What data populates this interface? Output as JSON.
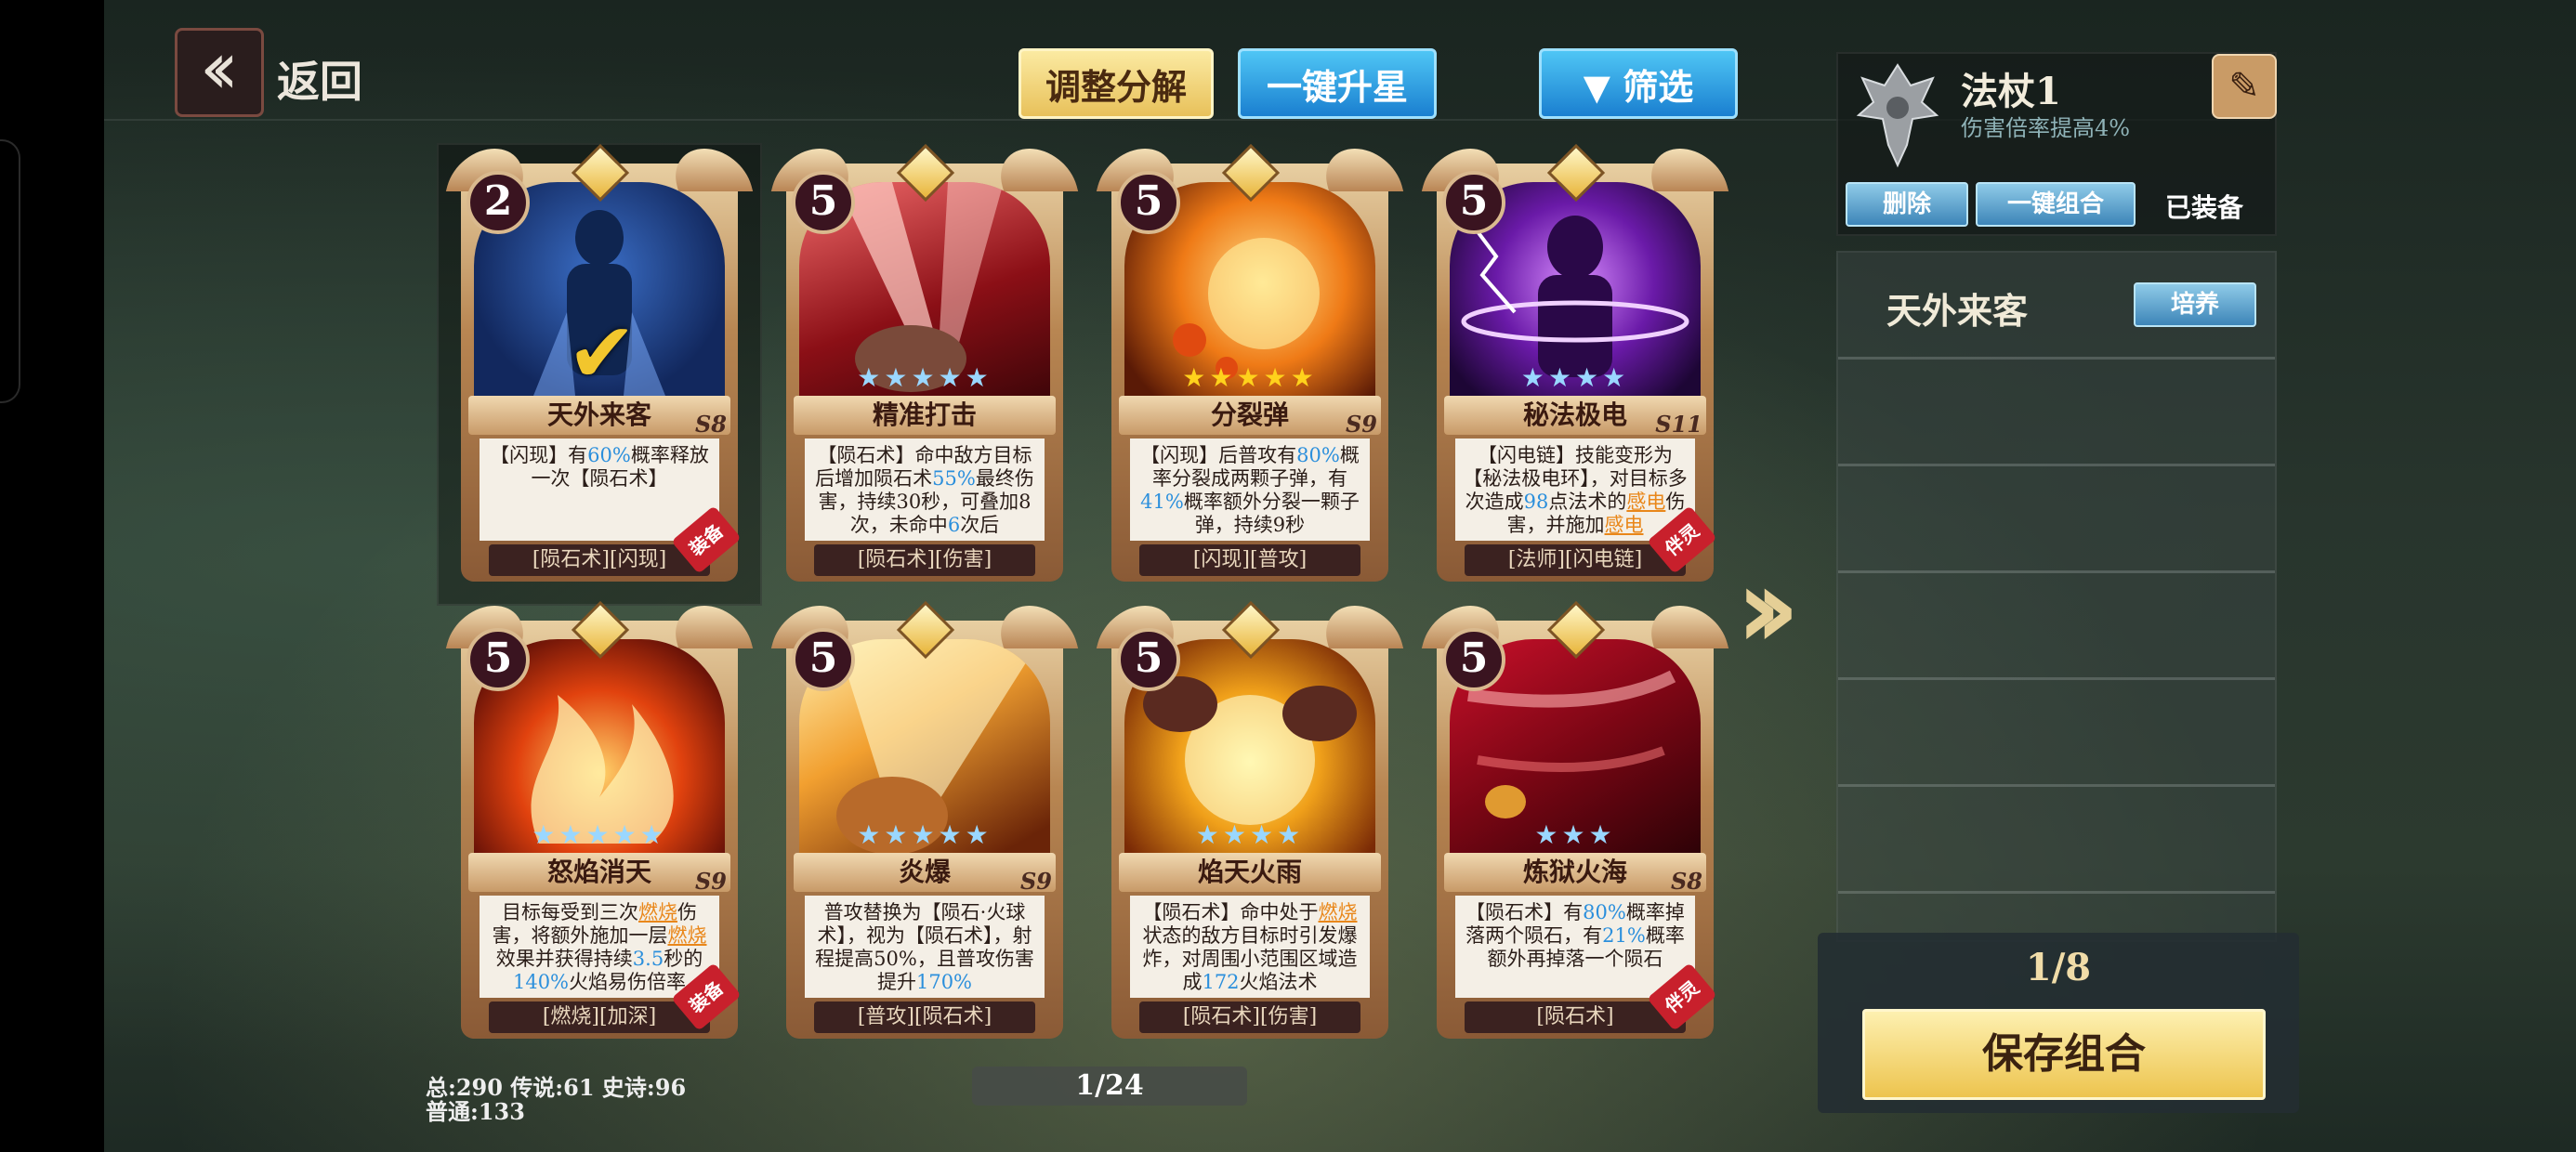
{
  "header": {
    "back_label": "返回"
  },
  "toolbar": {
    "adjust_label": "调整分解",
    "upgrade_label": "一键升星",
    "filter_label": "▼ 筛选"
  },
  "cards": [
    {
      "cost": "2",
      "name": "天外来客",
      "season": "S8",
      "desc": "【闪现】有60%概率释放一次【陨石术】",
      "tags": "[陨石术][闪现]",
      "ribbon": "装备",
      "selected": true
    },
    {
      "cost": "5",
      "name": "精准打击",
      "season": "",
      "desc": "【陨石术】命中敌方目标后增加陨石术55%最终伤害，持续30秒，可叠加8次，未命中6次后",
      "tags": "[陨石术][伤害]",
      "ribbon": ""
    },
    {
      "cost": "5",
      "name": "分裂弹",
      "season": "S9",
      "desc": "【闪现】后普攻有80%概率分裂成两颗子弹，有41%概率额外分裂一颗子弹，持续9秒",
      "tags": "[闪现][普攻]",
      "ribbon": ""
    },
    {
      "cost": "5",
      "name": "秘法极电",
      "season": "S11",
      "desc": "【闪电链】技能变形为【秘法极电环】，对目标多次造成98点法术的感电伤害，并施加感电",
      "tags": "[法师][闪电链]",
      "ribbon": "伴灵"
    },
    {
      "cost": "5",
      "name": "怒焰消天",
      "season": "S9",
      "desc": "目标每受到三次燃烧伤害，将额外施加一层燃烧效果并获得持续3.5秒的140%火焰易伤倍率",
      "tags": "[燃烧][加深]",
      "ribbon": "装备"
    },
    {
      "cost": "5",
      "name": "炎爆",
      "season": "S9",
      "desc": "普攻替换为【陨石·火球术】，视为【陨石术】，射程提高50%，且普攻伤害提升170%",
      "tags": "[普攻][陨石术]",
      "ribbon": ""
    },
    {
      "cost": "5",
      "name": "焰天火雨",
      "season": "",
      "desc": "【陨石术】命中处于燃烧状态的敌方目标时引发爆炸，对周围小范围区域造成172火焰法术",
      "tags": "[陨石术][伤害]",
      "ribbon": ""
    },
    {
      "cost": "5",
      "name": "炼狱火海",
      "season": "S8",
      "desc": "【陨石术】有80%概率掉落两个陨石，有21%概率额外再掉落一个陨石",
      "tags": "[陨石术]",
      "ribbon": "伴灵"
    }
  ],
  "footer": {
    "stats_line1": "总:290 传说:61 史诗:96",
    "stats_line2": "普通:133",
    "page": "1/24"
  },
  "panel": {
    "title": "法杖1",
    "subtitle": "伤害倍率提高4%",
    "delete_label": "删除",
    "combo_label": "一键组合",
    "equipped_label": "已装备",
    "slot1_name": "天外来客",
    "train_label": "培养",
    "count": "1/8",
    "save_label": "保存组合"
  },
  "colors": {
    "gold": "#edc44e",
    "blue": "#1a7fd0",
    "highlight_blue": "#2b8fdc",
    "highlight_orange": "#e9871a"
  }
}
